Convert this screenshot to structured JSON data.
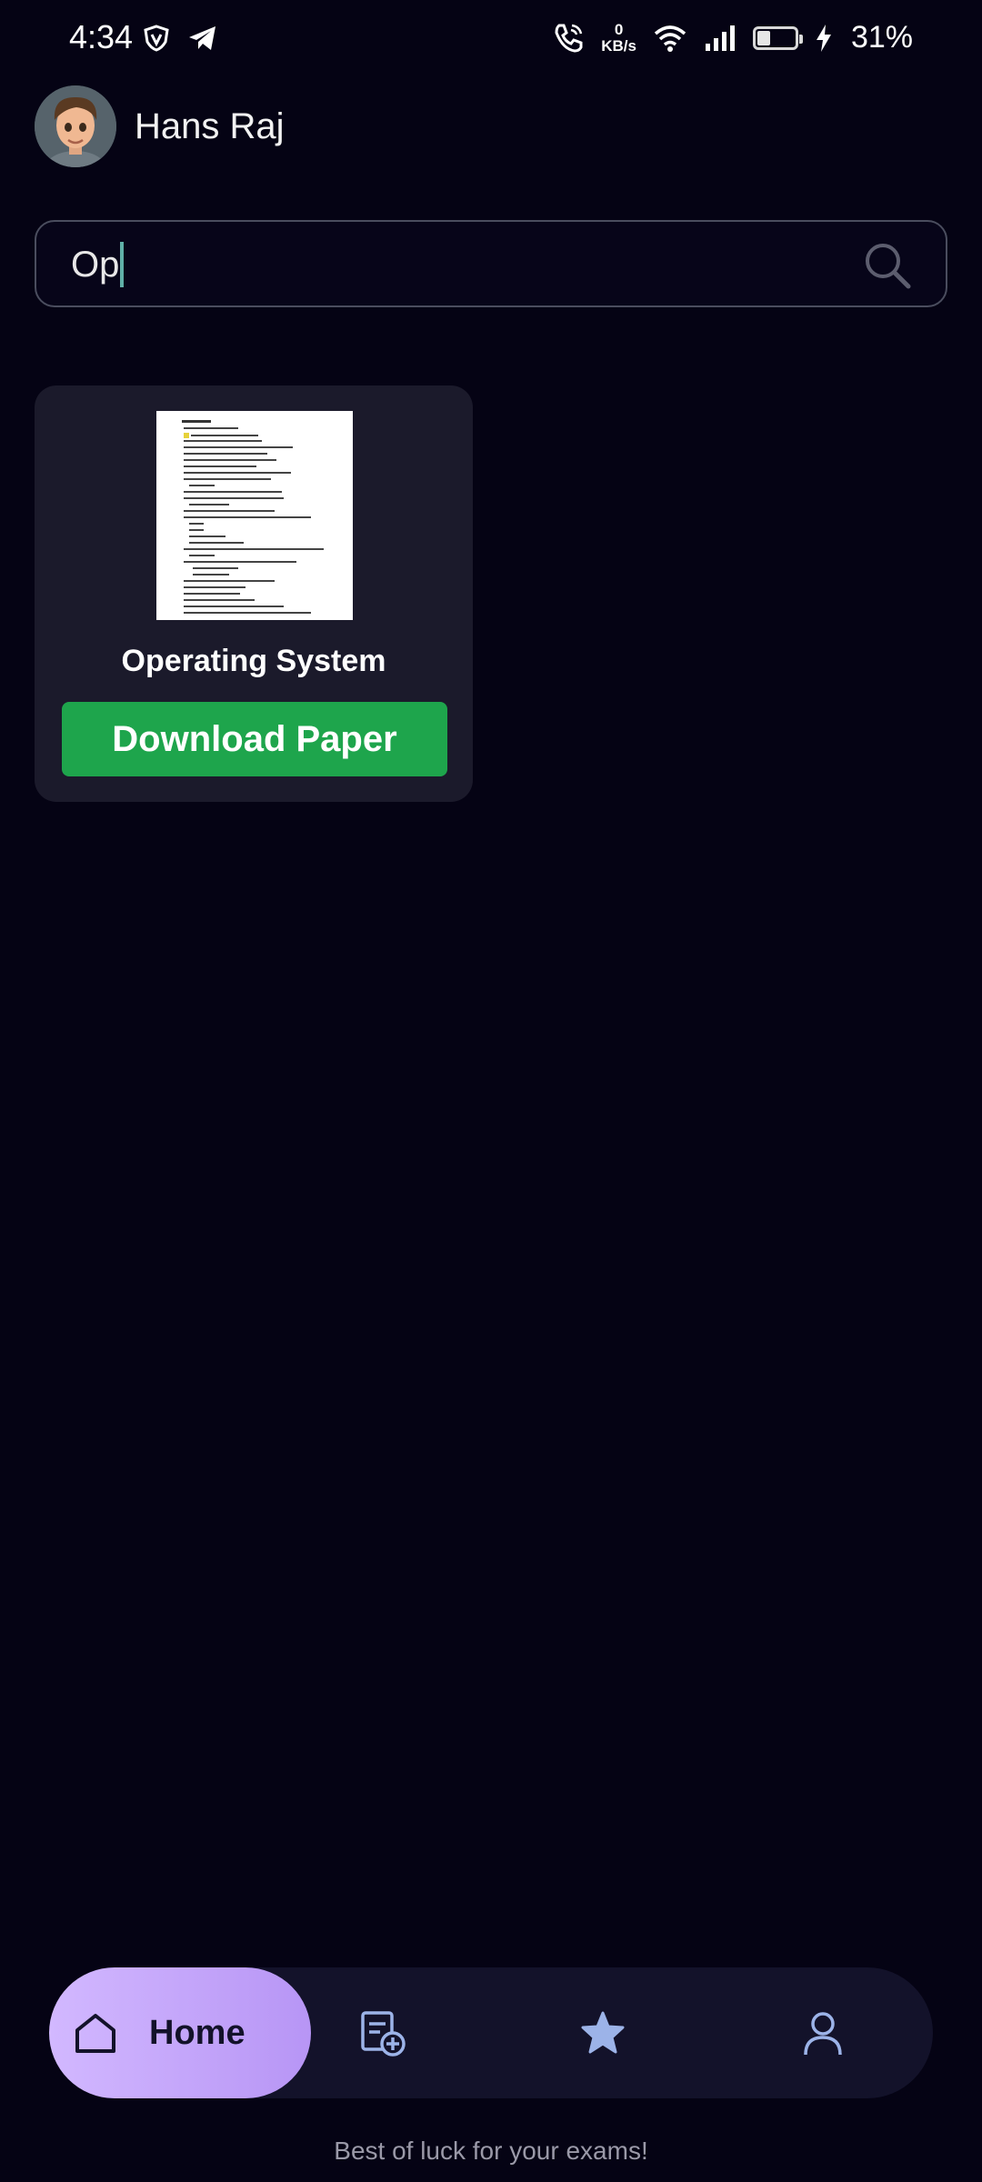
{
  "status_bar": {
    "time": "4:34",
    "net_speed_value": "0",
    "net_speed_unit": "KB/s",
    "battery_percent": "31%",
    "battery_level": 0.31
  },
  "header": {
    "user_name": "Hans Raj"
  },
  "search": {
    "value": "Op"
  },
  "results": [
    {
      "title": "Operating System",
      "button_label": "Download Paper"
    }
  ],
  "bottom_nav": {
    "items": [
      {
        "label": "Home",
        "icon": "home-icon",
        "active": true
      },
      {
        "label": "",
        "icon": "add-paper-icon",
        "active": false
      },
      {
        "label": "",
        "icon": "star-icon",
        "active": false
      },
      {
        "label": "",
        "icon": "profile-icon",
        "active": false
      }
    ]
  },
  "footer": {
    "text": "Best of luck for your exams!"
  },
  "colors": {
    "background": "#050314",
    "card": "#1b1a2b",
    "download_button": "#1ea54c",
    "nav_active_gradient_start": "#d2b8ff",
    "nav_active_gradient_end": "#b795f5",
    "nav_background": "#13122a",
    "nav_icon": "#9cb3e8"
  }
}
